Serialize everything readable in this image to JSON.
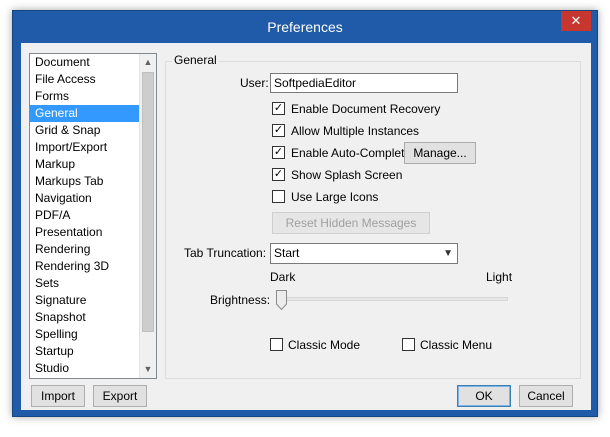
{
  "window": {
    "title": "Preferences",
    "close_glyph": "✕"
  },
  "sidebar": {
    "items": [
      {
        "label": "Document"
      },
      {
        "label": "File Access"
      },
      {
        "label": "Forms"
      },
      {
        "label": "General",
        "selected": true
      },
      {
        "label": "Grid & Snap"
      },
      {
        "label": "Import/Export"
      },
      {
        "label": "Markup"
      },
      {
        "label": "Markups Tab"
      },
      {
        "label": "Navigation"
      },
      {
        "label": "PDF/A"
      },
      {
        "label": "Presentation"
      },
      {
        "label": "Rendering"
      },
      {
        "label": "Rendering 3D"
      },
      {
        "label": "Sets"
      },
      {
        "label": "Signature"
      },
      {
        "label": "Snapshot"
      },
      {
        "label": "Spelling"
      },
      {
        "label": "Startup"
      },
      {
        "label": "Studio"
      }
    ]
  },
  "general": {
    "group_title": "General",
    "user_label": "User:",
    "user_value": "SoftpediaEditor",
    "checkboxes": {
      "enable_document_recovery": {
        "label": "Enable Document Recovery",
        "checked": true
      },
      "allow_multiple_instances": {
        "label": "Allow Multiple Instances",
        "checked": true
      },
      "enable_auto_complete": {
        "label": "Enable Auto-Complete",
        "checked": true
      },
      "show_splash_screen": {
        "label": "Show Splash Screen",
        "checked": true
      },
      "use_large_icons": {
        "label": "Use Large Icons",
        "checked": false
      },
      "classic_mode": {
        "label": "Classic Mode",
        "checked": false
      },
      "classic_menu": {
        "label": "Classic Menu",
        "checked": false
      }
    },
    "manage_button": "Manage...",
    "reset_hidden_messages_button": "Reset Hidden Messages",
    "tab_truncation_label": "Tab Truncation:",
    "tab_truncation_value": "Start",
    "dark_label": "Dark",
    "light_label": "Light",
    "brightness_label": "Brightness:",
    "brightness_level": 0
  },
  "footer": {
    "import_button": "Import",
    "export_button": "Export",
    "ok_button": "OK",
    "cancel_button": "Cancel"
  },
  "colors": {
    "title_bar": "#1f5ba8",
    "close_button": "#c7372f",
    "selection": "#3399ff"
  }
}
